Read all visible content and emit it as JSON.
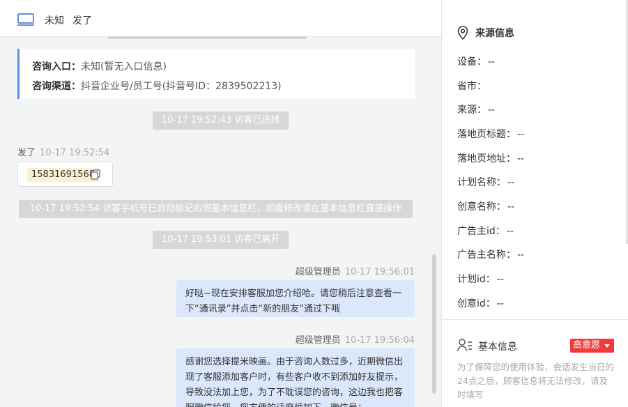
{
  "header": {
    "source": "未知",
    "visitor_name": "发了"
  },
  "entry_card": {
    "entry_label": "咨询入口：",
    "entry_value": "未知(暂无入口信息)",
    "channel_label": "咨询渠道：",
    "channel_value": "抖音企业号/员工号(抖音号ID：2839502213)"
  },
  "messages": {
    "system_enter": "10-17 19:52:43 访客已进线",
    "visitor": {
      "name": "发了",
      "time": "10-17 19:52:54",
      "phone": "15831691568"
    },
    "system_phone": "10-17 19:52:54 访客手机号已自动标记右侧基本信息栏，如需修改请在基本信息栏直接操作",
    "system_leave": "10-17 19:53:01 访客已离开",
    "agent1": {
      "name": "超级管理员",
      "time": "10-17 19:56:01",
      "text": "好哒~现在安排客服加您介绍哈。请您稍后注意查看一下“通讯录”并点击“新的朋友”通过下哦"
    },
    "agent2": {
      "name": "超级管理员",
      "time": "10-17 19:56:04",
      "text": "感谢您选择提米映画。由于咨询人数过多，近期微信出现了客服添加客户时，有些客户收不到添加好友提示，导致没法加上您，为了不耽误您的咨询，这边我也把客服微信给您，您方便的话麻烦加下。微信号："
    }
  },
  "side": {
    "source_title": "来源信息",
    "fields": [
      {
        "label": "设备：",
        "value": "--"
      },
      {
        "label": "省市：",
        "value": ""
      },
      {
        "label": "来源：",
        "value": "--"
      },
      {
        "label": "落地页标题：",
        "value": "--"
      },
      {
        "label": "落地页地址：",
        "value": "--"
      },
      {
        "label": "计划名称：",
        "value": "--"
      },
      {
        "label": "创意名称：",
        "value": "--"
      },
      {
        "label": "广告主id：",
        "value": "--"
      },
      {
        "label": "广告主名称：",
        "value": "--"
      },
      {
        "label": "计划id：",
        "value": "--"
      },
      {
        "label": "创意id：",
        "value": "--"
      }
    ],
    "basic_title": "基本信息",
    "intent": "高意愿",
    "notice": "为了保障您的使用体验，会话发生当日的24点之后，顾客信息将无法修改，请及时填写"
  },
  "icons": {
    "header": "monitor-icon",
    "copy": "copy-icon",
    "source": "location-pin-icon",
    "basic": "user-list-icon",
    "dropdown": "caret-down-icon"
  },
  "colors": {
    "accent": "#5b8fe0",
    "agent_bubble": "#dbe7fb",
    "phone_highlight": "#fdf0d2",
    "intent_badge": "#f23a3a",
    "system_msg": "#d6d7d9"
  }
}
